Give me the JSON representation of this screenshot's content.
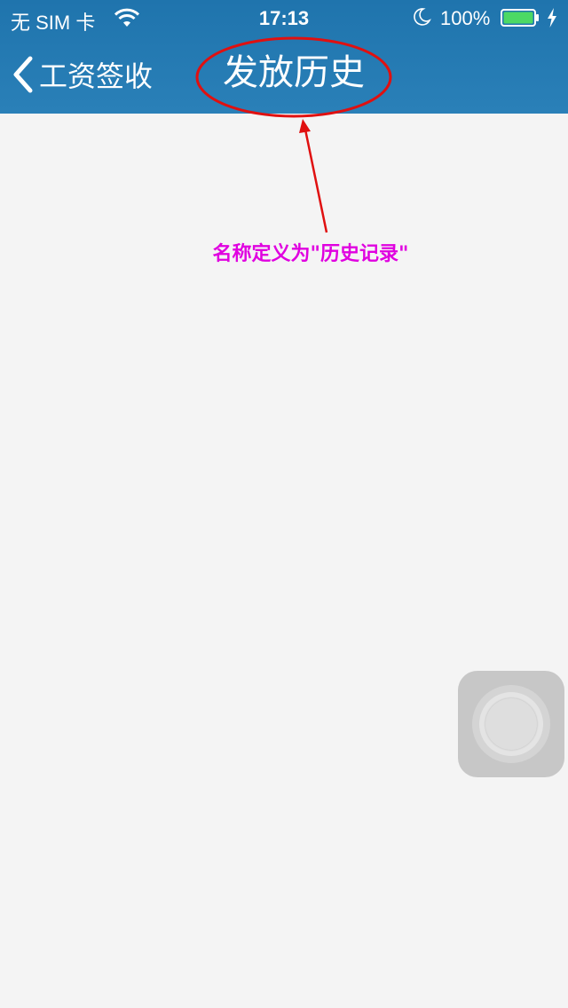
{
  "status_bar": {
    "carrier": "无 SIM 卡",
    "time": "17:13",
    "battery_percent": "100%",
    "icons": [
      "wifi-icon",
      "moon-icon",
      "battery-icon",
      "charging-icon"
    ]
  },
  "nav_bar": {
    "back_label": "工资签收",
    "title": "发放历史"
  },
  "annotation": {
    "note": "名称定义为\"历史记录\"",
    "color": "#e000e0",
    "mark_color": "#e01010"
  },
  "colors": {
    "nav_background": "#1f74ad",
    "page_background": "#f4f4f4",
    "battery_fill": "#4cd964"
  }
}
